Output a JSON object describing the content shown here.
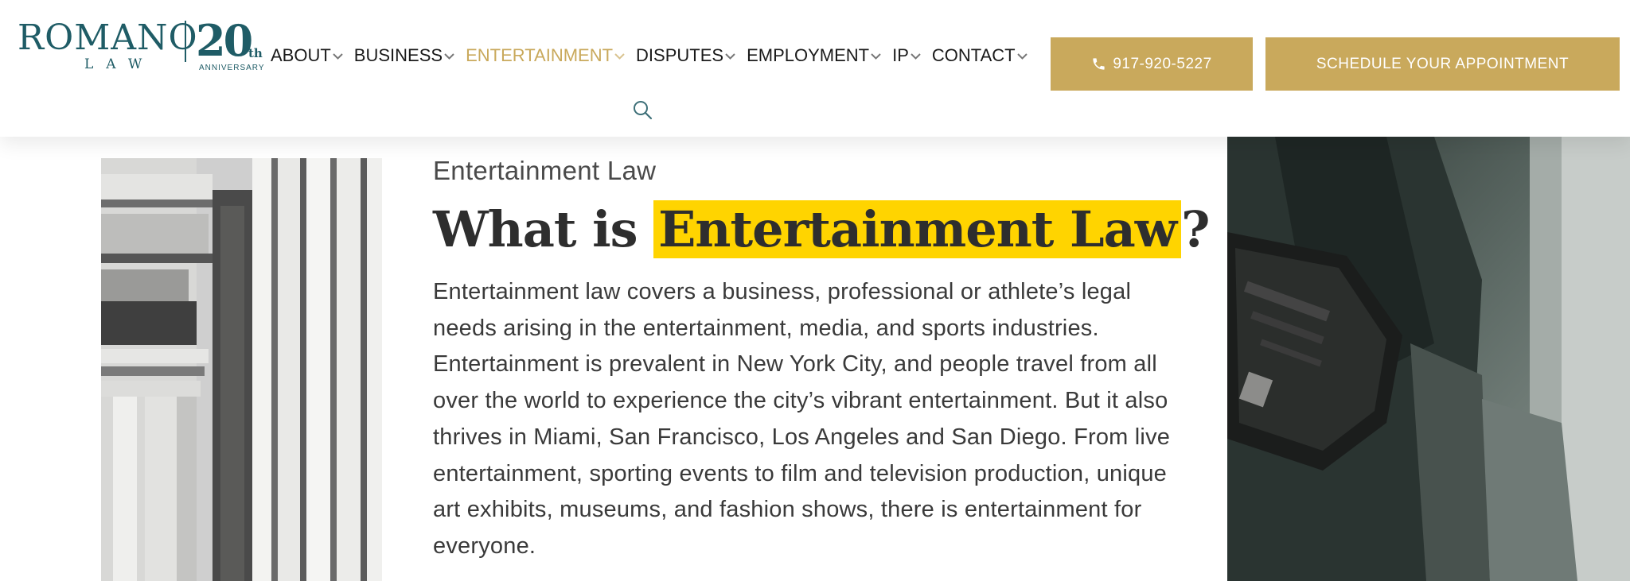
{
  "brand": {
    "name": "ROMANO",
    "sub": "LAW",
    "years": "20",
    "years_suffix": "th",
    "anniversary": "ANNIVERSARY"
  },
  "nav": {
    "items": [
      {
        "label": "ABOUT",
        "active": false
      },
      {
        "label": "BUSINESS",
        "active": false
      },
      {
        "label": "ENTERTAINMENT",
        "active": true
      },
      {
        "label": "DISPUTES",
        "active": false
      },
      {
        "label": "EMPLOYMENT",
        "active": false
      },
      {
        "label": "IP",
        "active": false
      },
      {
        "label": "CONTACT",
        "active": false
      }
    ],
    "search_icon": "search-icon"
  },
  "cta": {
    "phone": "917-920-5227",
    "appointment": "SCHEDULE YOUR APPOINTMENT"
  },
  "article": {
    "eyebrow": "Entertainment Law",
    "headline_pre": "What is ",
    "headline_highlight": "Entertainment Law",
    "headline_post": "?",
    "body": "Entertainment law covers a business, professional or athlete’s legal needs arising in the entertainment, media, and sports industries.  Entertainment is prevalent in New York City, and people travel from all over the world to experience the city’s vibrant entertainment.  But it also thrives in Miami, San Francisco, Los Angeles and San Diego.  From live entertainment, sporting events to film and television production, unique art exhibits, museums, and fashion shows, there is entertainment for everyone."
  },
  "colors": {
    "brand_teal": "#1f5c66",
    "gold": "#c9a95c",
    "highlight": "#ffd400",
    "text": "#2b2b2b"
  }
}
